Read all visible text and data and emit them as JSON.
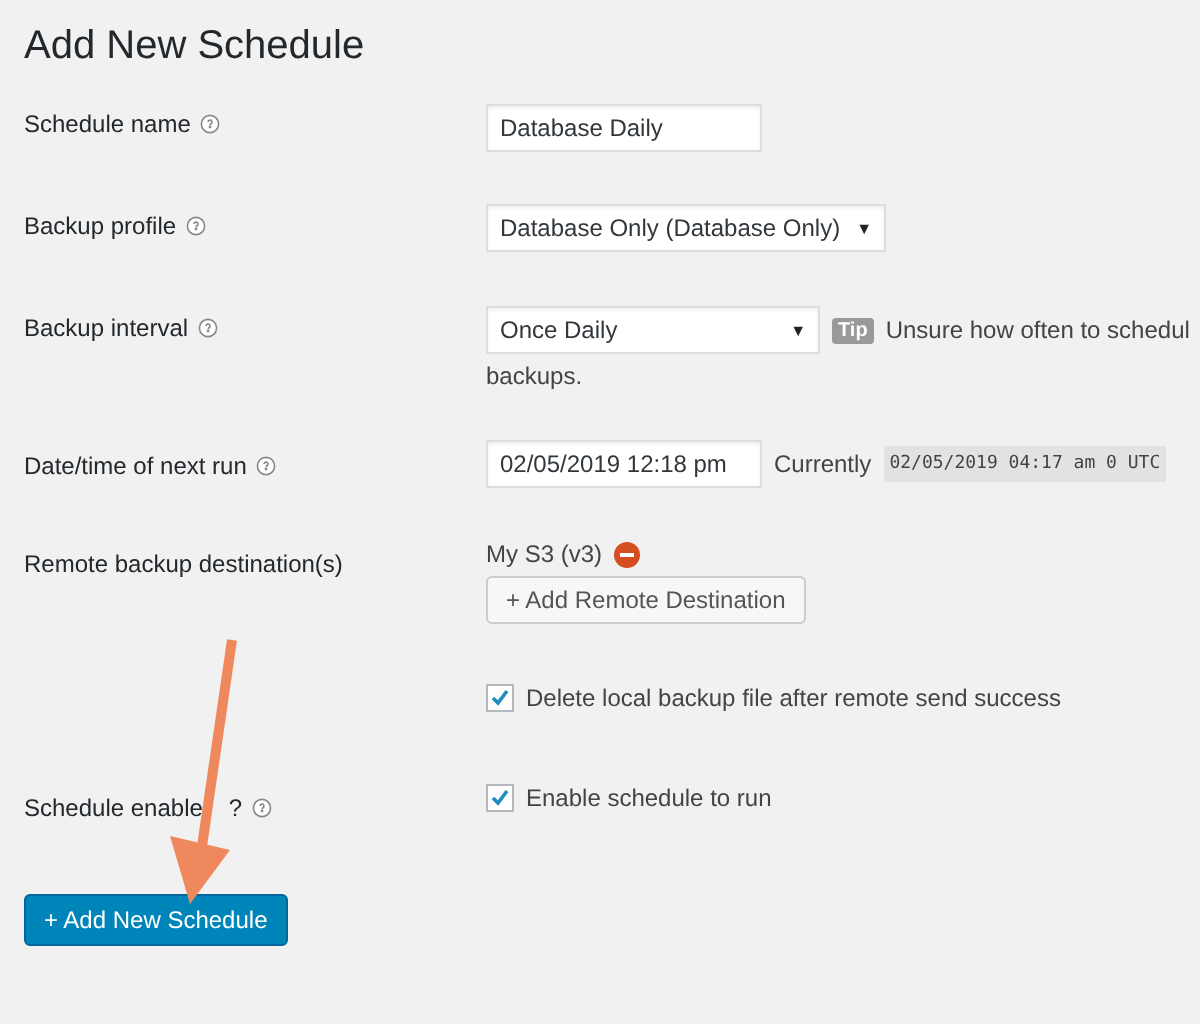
{
  "title": "Add New Schedule",
  "fields": [
    {
      "kind": "text",
      "label": "Schedule name",
      "help": true,
      "value": "Database Daily"
    },
    {
      "kind": "select",
      "label": "Backup profile",
      "help": true,
      "value": "Database Only (Database Only)",
      "caret": "▼"
    },
    {
      "kind": "interval",
      "label": "Backup interval",
      "help": true,
      "value": "Once Daily",
      "caret": "▼",
      "tip_badge": "Tip",
      "tip_text": "Unsure how often to schedul",
      "tip_more": "backups."
    },
    {
      "kind": "datetime",
      "label": "Date/time of next run",
      "help": true,
      "value": "02/05/2019 12:18 pm",
      "current_label": "Currently",
      "current_value": "02/05/2019 04:17 am 0 UTC"
    },
    {
      "kind": "remote",
      "label": "Remote backup destination(s)",
      "destination": "My S3 (v3)",
      "add_button": "+ Add Remote Destination"
    },
    {
      "kind": "checkbox",
      "checked": true,
      "text": "Delete local backup file after remote send success"
    },
    {
      "kind": "checkbox",
      "label": "Schedule enable",
      "label_suffix": "?",
      "help": true,
      "checked": true,
      "text": "Enable schedule to run"
    }
  ],
  "submit": "+ Add New Schedule"
}
